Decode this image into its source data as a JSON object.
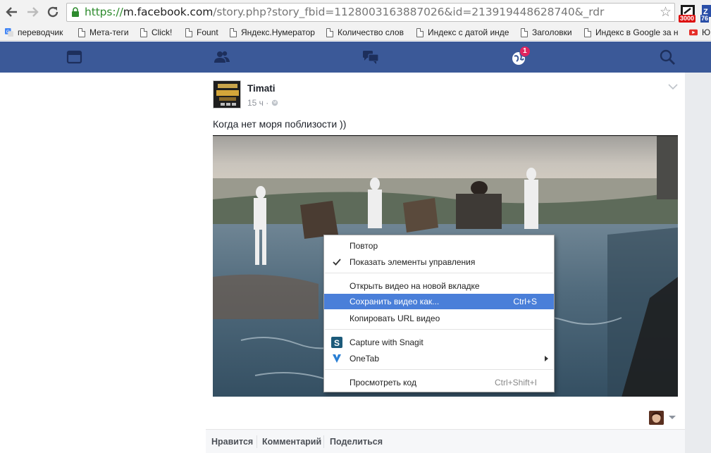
{
  "browser": {
    "url_scheme": "https://",
    "url_host": "m.facebook.com",
    "url_rest": "/story.php?story_fbid=1128003163887026&id=213919448628740&_rdr",
    "ext1_badge": "3000",
    "ext2_badge": "76"
  },
  "bookmarks": [
    {
      "label": "переводчик",
      "icon": "google-translate-icon"
    },
    {
      "label": "Мета-теги",
      "icon": "page-icon"
    },
    {
      "label": "Click!",
      "icon": "page-icon"
    },
    {
      "label": "Fount",
      "icon": "page-icon"
    },
    {
      "label": "Яндекс.Нумератор",
      "icon": "page-icon"
    },
    {
      "label": "Количество слов",
      "icon": "page-icon"
    },
    {
      "label": "Индекс с датой инде",
      "icon": "page-icon"
    },
    {
      "label": "Заголовки",
      "icon": "page-icon"
    },
    {
      "label": "Индекс в Google за н",
      "icon": "page-icon"
    },
    {
      "label": "Ю",
      "icon": "youtube-icon"
    }
  ],
  "fbbar": {
    "notification_count": "1",
    "color": "#3b5998"
  },
  "post": {
    "author": "Timati",
    "time": "15 ч",
    "caption": "Когда нет моря поблизости ))"
  },
  "context_menu": {
    "items": [
      {
        "label": "Повтор",
        "shortcut": ""
      },
      {
        "label": "Показать элементы управления",
        "shortcut": "",
        "checked": true
      },
      {
        "label": "Открыть видео на новой вкладке",
        "shortcut": ""
      },
      {
        "label": "Сохранить видео как...",
        "shortcut": "Ctrl+S",
        "highlighted": true
      },
      {
        "label": "Копировать URL видео",
        "shortcut": ""
      },
      {
        "label": "Capture with Snagit",
        "shortcut": "",
        "icon": "snagit-icon"
      },
      {
        "label": "OneTab",
        "shortcut": "",
        "icon": "onetab-icon",
        "submenu": true
      },
      {
        "label": "Просмотреть код",
        "shortcut": "Ctrl+Shift+I"
      }
    ]
  },
  "actions": {
    "like": "Нравится",
    "comment": "Комментарий",
    "share": "Поделиться"
  }
}
